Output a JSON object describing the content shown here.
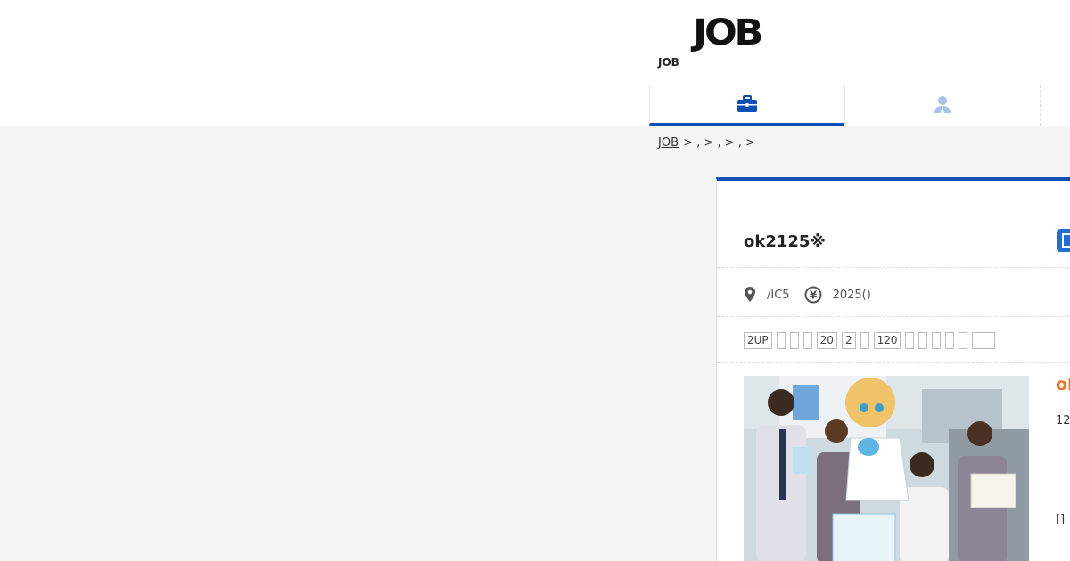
{
  "header": {
    "logo_text": "JOB",
    "site_name": "JOB"
  },
  "nav": {
    "tabs": [
      {
        "label": "",
        "icon": "briefcase-icon",
        "active": true
      },
      {
        "label": "",
        "icon": "user-icon",
        "active": false
      }
    ]
  },
  "breadcrumb": {
    "home": "JOB",
    "rest": " > , > , > , >"
  },
  "job": {
    "title": "ok2125※",
    "location": "/IC5",
    "salary": "2025()",
    "tags": [
      "2UP",
      "",
      "",
      "",
      "20",
      "2",
      "",
      "120",
      "",
      "",
      "",
      "",
      "",
      ""
    ],
    "side_title": "ok",
    "side_number": "12",
    "side_bracket": "[]"
  },
  "colors": {
    "accent": "#0a4fb3",
    "orange": "#e8742b",
    "bg": "#f4f5f4"
  }
}
